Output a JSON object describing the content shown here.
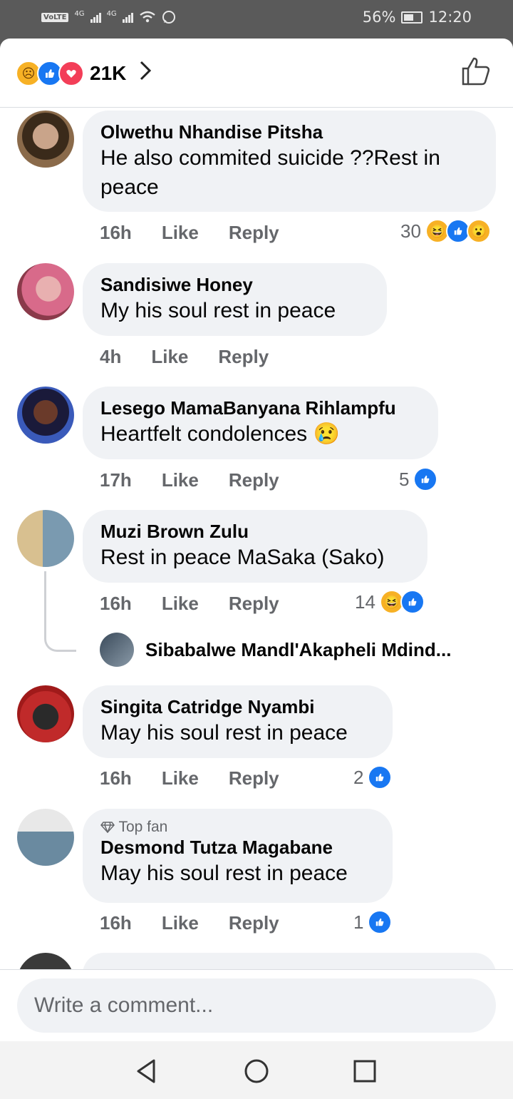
{
  "status_bar": {
    "volte": "VoLTE",
    "net1": "4G",
    "net2": "4G",
    "battery": "56%",
    "time": "12:20"
  },
  "header": {
    "reaction_count": "21K",
    "reactions": [
      "sad-icon",
      "like-icon",
      "love-icon"
    ]
  },
  "comments": [
    {
      "name": "Olwethu Nhandise Pitsha",
      "text_lines": [
        "He also commited suicide ??Rest in",
        "peace"
      ],
      "time": "16h",
      "like": "Like",
      "reply": "Reply",
      "reaction_count": "30",
      "reactions": [
        "haha",
        "like",
        "wow"
      ],
      "avatar_color": "#7a5a3a"
    },
    {
      "name": "Sandisiwe Honey",
      "text_lines": [
        "My his soul rest  in peace"
      ],
      "time": "4h",
      "like": "Like",
      "reply": "Reply",
      "reaction_count": "",
      "reactions": [],
      "avatar_color": "#c85a6a"
    },
    {
      "name": "Lesego MamaBanyana Rihlampfu",
      "text_lines": [
        "Heartfelt condolences 😢"
      ],
      "time": "17h",
      "like": "Like",
      "reply": "Reply",
      "reaction_count": "5",
      "reactions": [
        "like"
      ],
      "avatar_color": "#2a3a8a"
    },
    {
      "name": "Muzi Brown Zulu",
      "text_lines": [
        "Rest in peace MaSaka (Sako)"
      ],
      "time": "16h",
      "like": "Like",
      "reply": "Reply",
      "reaction_count": "14",
      "reactions": [
        "haha",
        "like"
      ],
      "avatar_color": "#8a9a7a"
    },
    {
      "name": "Singita Catridge Nyambi",
      "text_lines": [
        "May his soul rest in peace"
      ],
      "time": "16h",
      "like": "Like",
      "reply": "Reply",
      "reaction_count": "2",
      "reactions": [
        "like"
      ],
      "avatar_color": "#b02a2a"
    },
    {
      "name": "Desmond Tutza Magabane",
      "top_fan": "Top fan",
      "text_lines": [
        "May his soul rest in peace"
      ],
      "time": "16h",
      "like": "Like",
      "reply": "Reply",
      "reaction_count": "1",
      "reactions": [
        "like"
      ],
      "avatar_color": "#7a8a9a"
    }
  ],
  "reply_preview": {
    "name": "Sibabalwe Mandl'Akapheli Mdind..."
  },
  "composer": {
    "placeholder": "Write a comment..."
  },
  "nav": {
    "back": "back-icon",
    "home": "home-icon",
    "recents": "recents-icon"
  }
}
